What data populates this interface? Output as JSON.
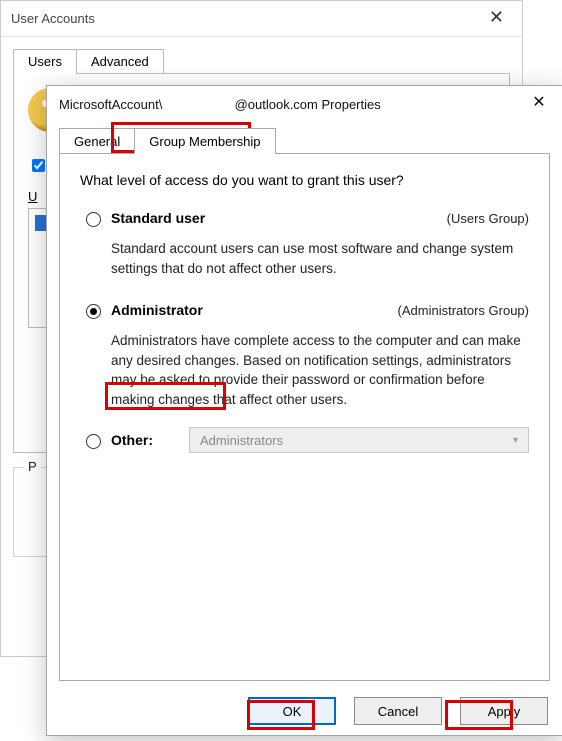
{
  "bg": {
    "title": "User Accounts",
    "tabs": [
      "Users",
      "Advanced"
    ],
    "users_label_prefix": "U",
    "p_label": "P"
  },
  "dialog": {
    "title_prefix": "MicrosoftAccount\\",
    "title_email_blank": "                    ",
    "title_suffix": "@outlook.com Properties",
    "tabs": {
      "general": "General",
      "group": "Group Membership"
    },
    "question": "What level of access do you want to grant this user?",
    "standard": {
      "label": "Standard user",
      "group": "(Users Group)",
      "desc": "Standard account users can use most software and change system settings that do not affect other users."
    },
    "admin": {
      "label": "Administrator",
      "group": "(Administrators Group)",
      "desc": "Administrators have complete access to the computer and can make any desired changes. Based on notification settings, administrators may be asked to provide their password or confirmation before making changes that affect other users."
    },
    "other": {
      "label": "Other:",
      "selected": "Administrators"
    },
    "buttons": {
      "ok": "OK",
      "cancel": "Cancel",
      "apply": "Apply"
    }
  }
}
